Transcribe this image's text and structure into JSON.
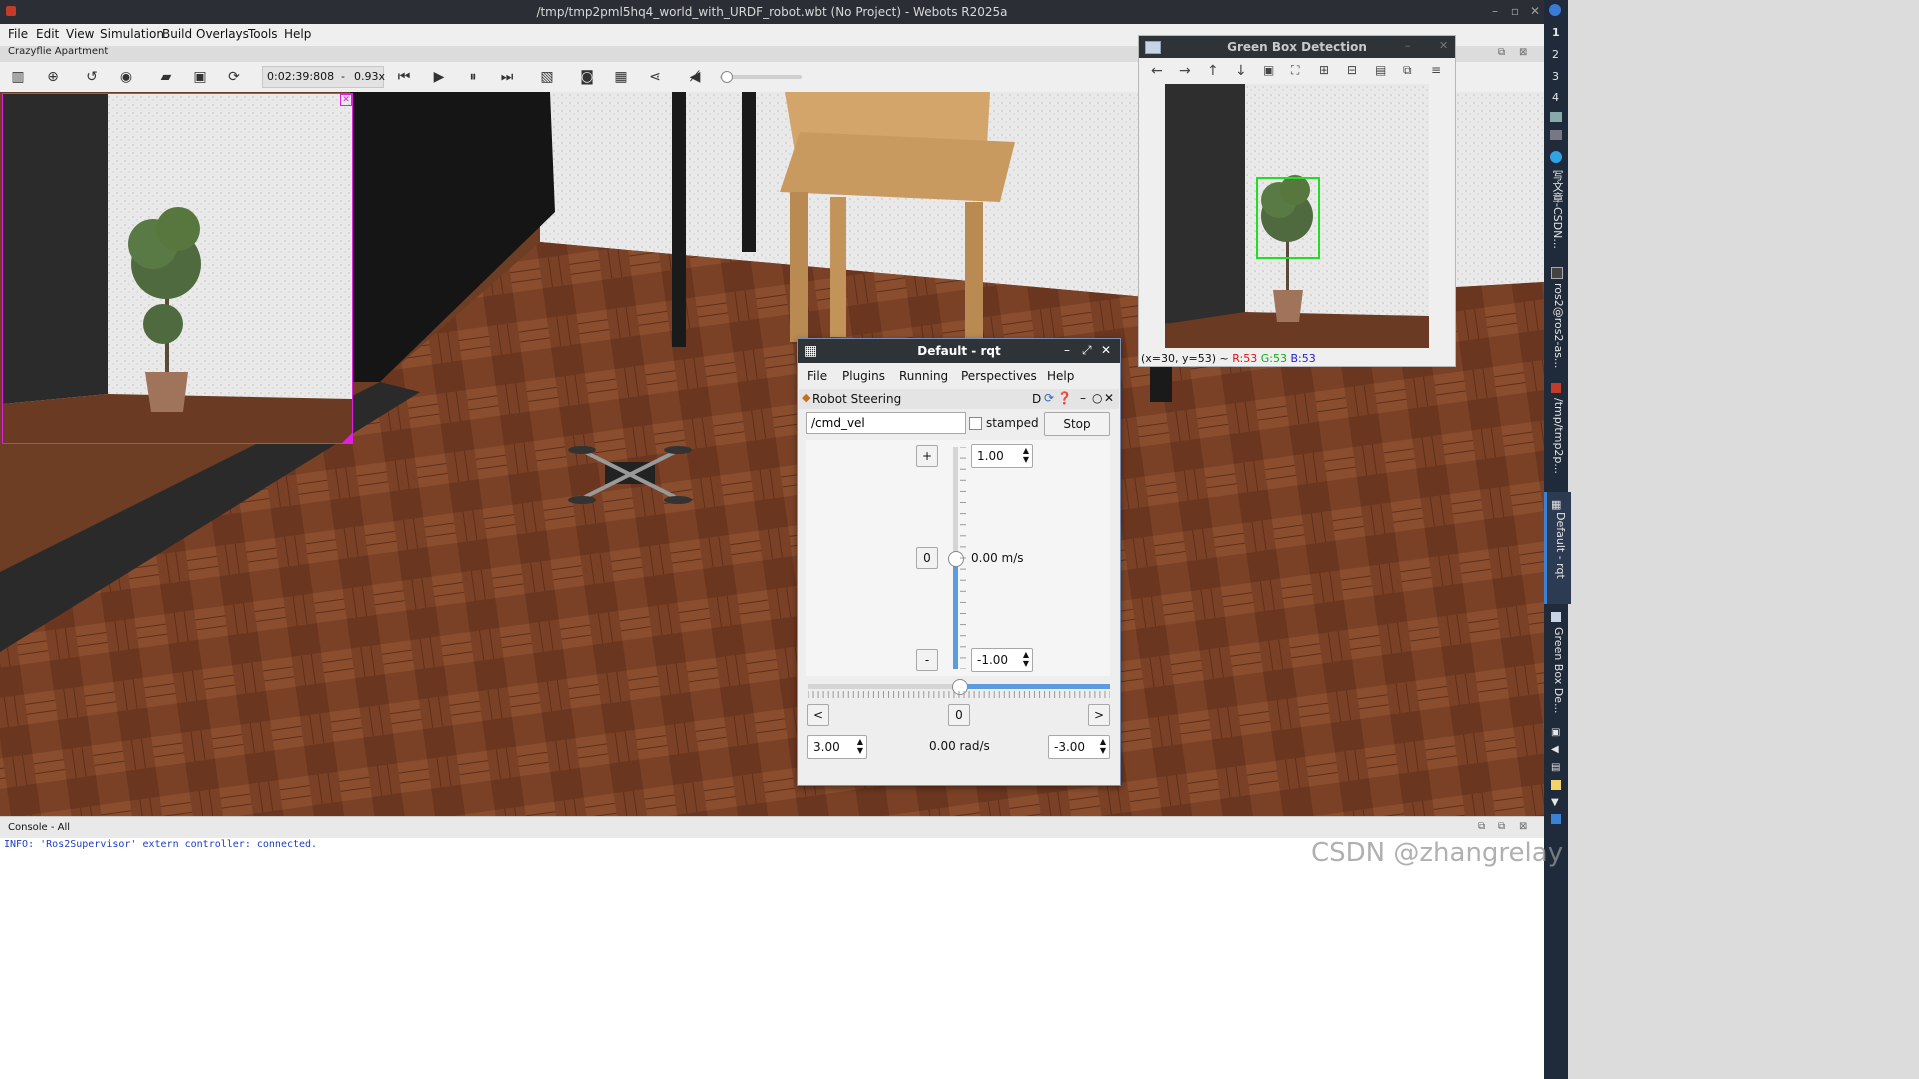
{
  "window": {
    "title": "/tmp/tmp2pml5hq4_world_with_URDF_robot.wbt (No Project) - Webots R2025a",
    "world_label": "Crazyflie Apartment"
  },
  "menu": [
    "File",
    "Edit",
    "View",
    "Simulation",
    "Build",
    "Overlays",
    "Tools",
    "Help"
  ],
  "toolbar": {
    "time": "0:02:39:808",
    "separator": "-",
    "speed": "0.93x",
    "volume_level": 0.02
  },
  "icons": {
    "toolbar": [
      "panel-icon",
      "add-node-icon",
      "reset-view-icon",
      "eye-icon",
      "open-icon",
      "save-icon",
      "reload-icon",
      "step-back-icon",
      "play-icon",
      "pause-icon",
      "fast-forward-icon",
      "render-icon",
      "camera-icon",
      "movie-icon",
      "share-icon",
      "mute-icon"
    ]
  },
  "colors": {
    "selection": "#e020e0",
    "detection_box": "#22dd22",
    "accent": "#3b82d6"
  },
  "rqt": {
    "title": "Default - rqt",
    "menu": [
      "File",
      "Plugins",
      "Running",
      "Perspectives",
      "Help"
    ],
    "plugin_title": "Robot Steering",
    "plugin_controls": "D",
    "topic": "/cmd_vel",
    "stamped_label": "stamped",
    "stop_label": "Stop",
    "plus_label": "+",
    "zero_label": "0",
    "minus_label": "-",
    "lin_max": "1.00",
    "lin_min": "-1.00",
    "lin_value": "0.00 m/s",
    "ang_left_label": "<",
    "ang_zero_label": "0",
    "ang_right_label": ">",
    "ang_max": "3.00",
    "ang_min": "-3.00",
    "ang_value": "0.00 rad/s",
    "linear_slider_fraction": 0.5,
    "angular_slider_fraction": 0.5
  },
  "gbd": {
    "title": "Green Box Detection",
    "status_prefix": "(x=30, y=53) ~ ",
    "r": "R:53",
    "g": "G:53",
    "b": "B:53"
  },
  "console": {
    "title": "Console - All",
    "message": "INFO: 'Ros2Supervisor' extern controller: connected."
  },
  "side_panel": {
    "numbers": [
      "1",
      "2",
      "3",
      "4"
    ],
    "labels": [
      "写文章-CSDN...",
      "ros2@ros2-as...",
      "/tmp/tmp2p...",
      "Default - rqt",
      "Green Box De..."
    ]
  },
  "watermark": "CSDN @zhangrelay"
}
